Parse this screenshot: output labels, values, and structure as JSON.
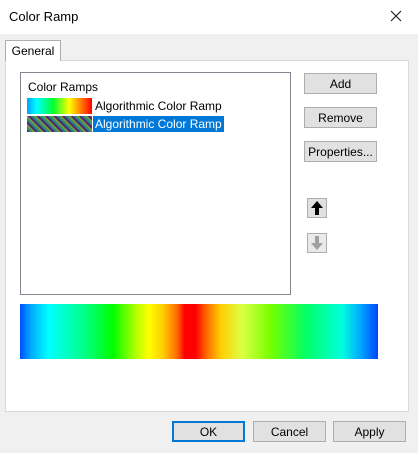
{
  "window": {
    "title": "Color Ramp",
    "close_icon": "close-icon"
  },
  "tabs": [
    {
      "label": "General"
    }
  ],
  "list": {
    "header": "Color Ramps",
    "items": [
      {
        "label": "Algorithmic Color Ramp",
        "selected": false,
        "swatch": "rainbow-gradient"
      },
      {
        "label": "Algorithmic Color Ramp",
        "selected": true,
        "swatch": "dark-hatched-gradient"
      }
    ]
  },
  "buttons": {
    "add": "Add",
    "remove": "Remove",
    "properties": "Properties..."
  },
  "arrows": {
    "up": "arrow-up-icon",
    "down": "arrow-down-icon"
  },
  "preview": {
    "name": "color-ramp-preview"
  },
  "footer": {
    "ok": "OK",
    "cancel": "Cancel",
    "apply": "Apply"
  },
  "colors": {
    "selection": "#0078d7",
    "button_bg": "#e1e1e1",
    "dialog_bg": "#f0f0f0"
  }
}
